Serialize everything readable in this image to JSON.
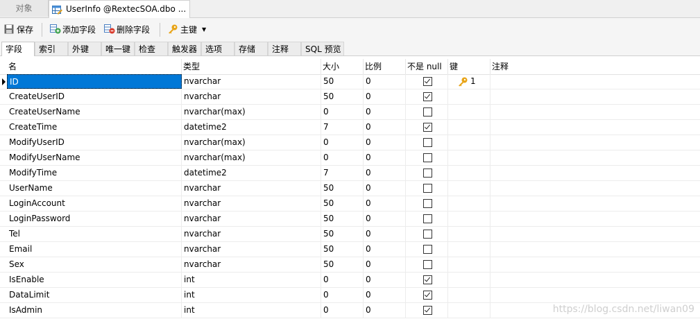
{
  "doc_tabs": {
    "objects": "对象",
    "active": "UserInfo @RextecSOA.dbo ..."
  },
  "toolbar": {
    "save": "保存",
    "add_field": "添加字段",
    "delete_field": "删除字段",
    "primary_key": "主键"
  },
  "sub_tabs": [
    "字段",
    "索引",
    "外键",
    "唯一键",
    "检查",
    "触发器",
    "选项",
    "存储",
    "注释",
    "SQL 预览"
  ],
  "grid": {
    "headers": [
      "名",
      "类型",
      "大小",
      "比例",
      "不是 null",
      "键",
      "注释"
    ],
    "rows": [
      {
        "name": "ID",
        "type": "nvarchar",
        "size": "50",
        "scale": "0",
        "not_null": true,
        "key": "1"
      },
      {
        "name": "CreateUserID",
        "type": "nvarchar",
        "size": "50",
        "scale": "0",
        "not_null": true,
        "key": ""
      },
      {
        "name": "CreateUserName",
        "type": "nvarchar(max)",
        "size": "0",
        "scale": "0",
        "not_null": false,
        "key": ""
      },
      {
        "name": "CreateTime",
        "type": "datetime2",
        "size": "7",
        "scale": "0",
        "not_null": true,
        "key": ""
      },
      {
        "name": "ModifyUserID",
        "type": "nvarchar(max)",
        "size": "0",
        "scale": "0",
        "not_null": false,
        "key": ""
      },
      {
        "name": "ModifyUserName",
        "type": "nvarchar(max)",
        "size": "0",
        "scale": "0",
        "not_null": false,
        "key": ""
      },
      {
        "name": "ModifyTime",
        "type": "datetime2",
        "size": "7",
        "scale": "0",
        "not_null": false,
        "key": ""
      },
      {
        "name": "UserName",
        "type": "nvarchar",
        "size": "50",
        "scale": "0",
        "not_null": false,
        "key": ""
      },
      {
        "name": "LoginAccount",
        "type": "nvarchar",
        "size": "50",
        "scale": "0",
        "not_null": false,
        "key": ""
      },
      {
        "name": "LoginPassword",
        "type": "nvarchar",
        "size": "50",
        "scale": "0",
        "not_null": false,
        "key": ""
      },
      {
        "name": "Tel",
        "type": "nvarchar",
        "size": "50",
        "scale": "0",
        "not_null": false,
        "key": ""
      },
      {
        "name": "Email",
        "type": "nvarchar",
        "size": "50",
        "scale": "0",
        "not_null": false,
        "key": ""
      },
      {
        "name": "Sex",
        "type": "nvarchar",
        "size": "50",
        "scale": "0",
        "not_null": false,
        "key": ""
      },
      {
        "name": "IsEnable",
        "type": "int",
        "size": "0",
        "scale": "0",
        "not_null": true,
        "key": ""
      },
      {
        "name": "DataLimit",
        "type": "int",
        "size": "0",
        "scale": "0",
        "not_null": true,
        "key": ""
      },
      {
        "name": "IsAdmin",
        "type": "int",
        "size": "0",
        "scale": "0",
        "not_null": true,
        "key": ""
      }
    ]
  },
  "watermark": "https://blog.csdn.net/liwan09"
}
